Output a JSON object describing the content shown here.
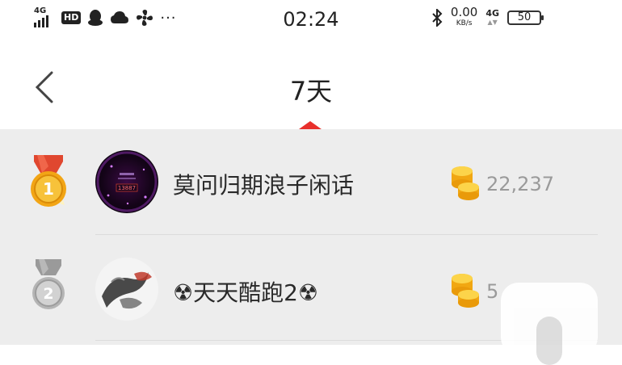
{
  "status_bar": {
    "network_label": "4G",
    "hd_badge": "HD",
    "more_dots": "···",
    "time": "02:24",
    "speed_value": "0.00",
    "speed_unit": "KB/s",
    "network_right": "4G",
    "battery_level": "50"
  },
  "header": {
    "title": "7天"
  },
  "leaderboard": [
    {
      "rank": "1",
      "name": "莫问归期浪子闲话",
      "avatar_text": "13887",
      "score": "22,237"
    },
    {
      "rank": "2",
      "name": "☢天天酷跑2☢",
      "score": "5"
    }
  ],
  "colors": {
    "accent_red": "#e8302c",
    "gold": "#f2a515",
    "silver": "#a8a8a8",
    "list_bg": "#ededed"
  }
}
